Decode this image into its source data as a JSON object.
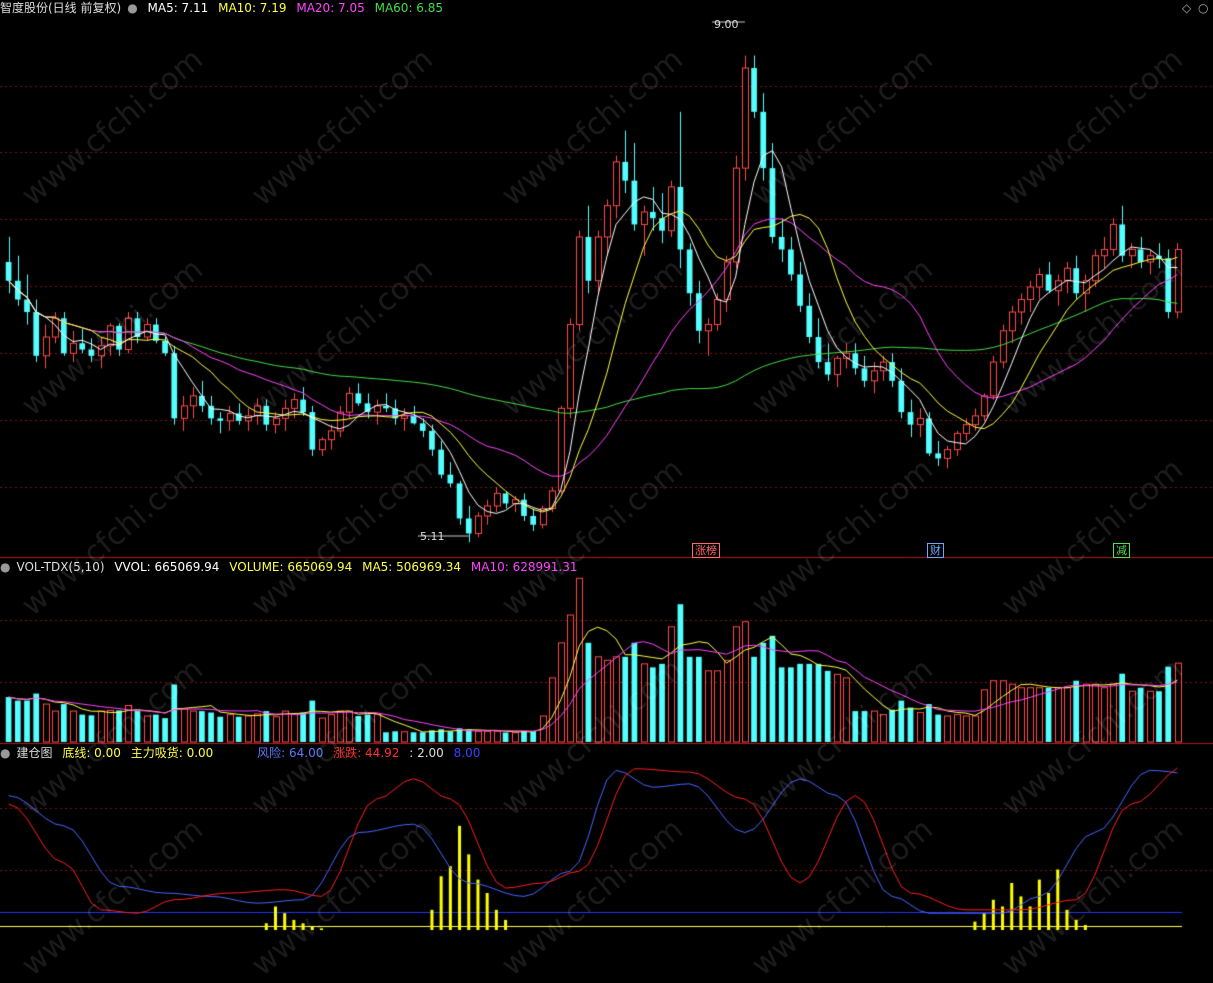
{
  "main_header": {
    "title": "智度股份(日线 前复权)",
    "ma5": "MA5: 7.11",
    "ma10": "MA10: 7.19",
    "ma20": "MA20: 7.05",
    "ma60": "MA60: 6.85"
  },
  "price_annotations": {
    "high": "9.00",
    "low": "5.11"
  },
  "event_tags": [
    "涨榜",
    "财",
    "减"
  ],
  "vol_header": {
    "title": "VOL-TDX(5,10)",
    "vvol": "VVOL: 665069.94",
    "volume": "VOLUME: 665069.94",
    "ma5": "MA5: 506969.34",
    "ma10": "MA10: 628991.31"
  },
  "ind_header": {
    "title": "建仓图",
    "bottom_line": "底线: 0.00",
    "main_absorb": "主力吸货: 0.00",
    "risk": "风险: 64.00",
    "change": "涨跌: 44.92",
    "val2": ": 2.00",
    "val8": "8.00"
  },
  "watermark": "www.cfchi.com",
  "colors": {
    "up": "#ff4a4a",
    "down": "#54ffff",
    "ma5": "#ffffff",
    "ma10": "#ffff44",
    "ma20": "#ff44ff",
    "ma60": "#44dd44",
    "grid": "#7a1010",
    "risk": "#4a66ff",
    "change": "#ff2020",
    "absorb": "#ffff00"
  },
  "chart_data": {
    "type": "candlestick",
    "price_range": [
      5.0,
      9.3
    ],
    "candles": [
      [
        7.35,
        7.55,
        7.1,
        7.2
      ],
      [
        7.2,
        7.4,
        7.0,
        7.05
      ],
      [
        7.05,
        7.25,
        6.85,
        6.95
      ],
      [
        6.95,
        7.05,
        6.55,
        6.6
      ],
      [
        6.6,
        6.85,
        6.5,
        6.75
      ],
      [
        6.75,
        6.95,
        6.7,
        6.9
      ],
      [
        6.9,
        6.95,
        6.6,
        6.62
      ],
      [
        6.62,
        6.8,
        6.55,
        6.7
      ],
      [
        6.7,
        6.82,
        6.62,
        6.65
      ],
      [
        6.65,
        6.74,
        6.55,
        6.6
      ],
      [
        6.6,
        6.75,
        6.5,
        6.68
      ],
      [
        6.68,
        6.86,
        6.6,
        6.84
      ],
      [
        6.84,
        6.86,
        6.6,
        6.65
      ],
      [
        6.65,
        6.95,
        6.62,
        6.9
      ],
      [
        6.9,
        6.95,
        6.7,
        6.75
      ],
      [
        6.75,
        6.9,
        6.72,
        6.85
      ],
      [
        6.85,
        6.9,
        6.7,
        6.72
      ],
      [
        6.72,
        6.75,
        6.6,
        6.62
      ],
      [
        6.62,
        6.68,
        6.05,
        6.1
      ],
      [
        6.1,
        6.28,
        6.0,
        6.2
      ],
      [
        6.2,
        6.35,
        6.1,
        6.28
      ],
      [
        6.28,
        6.4,
        6.15,
        6.2
      ],
      [
        6.2,
        6.28,
        6.05,
        6.1
      ],
      [
        6.1,
        6.15,
        5.98,
        6.08
      ],
      [
        6.08,
        6.2,
        6.0,
        6.14
      ],
      [
        6.14,
        6.22,
        6.05,
        6.08
      ],
      [
        6.08,
        6.18,
        6.0,
        6.12
      ],
      [
        6.12,
        6.26,
        6.05,
        6.2
      ],
      [
        6.2,
        6.25,
        6.0,
        6.05
      ],
      [
        6.05,
        6.15,
        5.98,
        6.1
      ],
      [
        6.1,
        6.25,
        6.0,
        6.18
      ],
      [
        6.18,
        6.3,
        6.1,
        6.25
      ],
      [
        6.25,
        6.35,
        6.12,
        6.15
      ],
      [
        6.15,
        6.2,
        5.8,
        5.85
      ],
      [
        5.85,
        5.95,
        5.8,
        5.93
      ],
      [
        5.93,
        6.05,
        5.85,
        6.0
      ],
      [
        6.0,
        6.2,
        5.95,
        6.15
      ],
      [
        6.15,
        6.35,
        6.1,
        6.3
      ],
      [
        6.3,
        6.38,
        6.2,
        6.22
      ],
      [
        6.22,
        6.3,
        6.1,
        6.15
      ],
      [
        6.15,
        6.25,
        6.05,
        6.2
      ],
      [
        6.2,
        6.3,
        6.15,
        6.18
      ],
      [
        6.18,
        6.25,
        6.05,
        6.1
      ],
      [
        6.1,
        6.18,
        6.0,
        6.12
      ],
      [
        6.12,
        6.2,
        6.05,
        6.06
      ],
      [
        6.06,
        6.1,
        5.95,
        6.0
      ],
      [
        6.0,
        6.05,
        5.8,
        5.85
      ],
      [
        5.85,
        5.92,
        5.62,
        5.65
      ],
      [
        5.65,
        5.75,
        5.55,
        5.58
      ],
      [
        5.58,
        5.6,
        5.25,
        5.3
      ],
      [
        5.3,
        5.4,
        5.11,
        5.18
      ],
      [
        5.18,
        5.35,
        5.15,
        5.32
      ],
      [
        5.32,
        5.45,
        5.25,
        5.4
      ],
      [
        5.4,
        5.55,
        5.35,
        5.5
      ],
      [
        5.5,
        5.52,
        5.38,
        5.42
      ],
      [
        5.42,
        5.48,
        5.35,
        5.45
      ],
      [
        5.45,
        5.5,
        5.28,
        5.32
      ],
      [
        5.32,
        5.38,
        5.2,
        5.25
      ],
      [
        5.25,
        5.4,
        5.22,
        5.38
      ],
      [
        5.38,
        5.55,
        5.35,
        5.52
      ],
      [
        5.52,
        6.2,
        5.5,
        6.18
      ],
      [
        6.18,
        6.9,
        6.1,
        6.85
      ],
      [
        6.85,
        7.6,
        6.8,
        7.55
      ],
      [
        7.55,
        7.8,
        7.1,
        7.2
      ],
      [
        7.2,
        7.6,
        7.1,
        7.55
      ],
      [
        7.55,
        7.85,
        7.4,
        7.8
      ],
      [
        7.8,
        8.2,
        7.7,
        8.15
      ],
      [
        8.15,
        8.4,
        7.9,
        8.0
      ],
      [
        8.0,
        8.3,
        7.6,
        7.65
      ],
      [
        7.65,
        7.8,
        7.4,
        7.75
      ],
      [
        7.75,
        7.95,
        7.6,
        7.7
      ],
      [
        7.7,
        7.9,
        7.5,
        7.6
      ],
      [
        7.6,
        8.0,
        7.55,
        7.95
      ],
      [
        7.95,
        8.55,
        7.3,
        7.45
      ],
      [
        7.45,
        7.5,
        7.0,
        7.1
      ],
      [
        7.1,
        7.2,
        6.7,
        6.8
      ],
      [
        6.8,
        6.9,
        6.6,
        6.85
      ],
      [
        6.85,
        7.1,
        6.8,
        7.05
      ],
      [
        7.05,
        7.4,
        6.95,
        7.35
      ],
      [
        7.35,
        8.2,
        7.3,
        8.1
      ],
      [
        8.1,
        9.0,
        8.0,
        8.9
      ],
      [
        8.9,
        9.0,
        8.5,
        8.55
      ],
      [
        8.55,
        8.7,
        8.0,
        8.1
      ],
      [
        8.1,
        8.3,
        7.5,
        7.55
      ],
      [
        7.55,
        7.7,
        7.35,
        7.45
      ],
      [
        7.45,
        7.55,
        7.2,
        7.25
      ],
      [
        7.25,
        7.35,
        6.95,
        7.0
      ],
      [
        7.0,
        7.1,
        6.7,
        6.75
      ],
      [
        6.75,
        6.9,
        6.5,
        6.55
      ],
      [
        6.55,
        6.7,
        6.4,
        6.45
      ],
      [
        6.45,
        6.6,
        6.35,
        6.58
      ],
      [
        6.58,
        6.7,
        6.5,
        6.62
      ],
      [
        6.62,
        6.7,
        6.45,
        6.5
      ],
      [
        6.5,
        6.6,
        6.35,
        6.4
      ],
      [
        6.4,
        6.55,
        6.3,
        6.48
      ],
      [
        6.48,
        6.6,
        6.4,
        6.55
      ],
      [
        6.55,
        6.62,
        6.35,
        6.4
      ],
      [
        6.4,
        6.5,
        6.1,
        6.15
      ],
      [
        6.15,
        6.25,
        5.95,
        6.05
      ],
      [
        6.05,
        6.18,
        5.95,
        6.1
      ],
      [
        6.1,
        6.15,
        5.8,
        5.82
      ],
      [
        5.82,
        5.92,
        5.72,
        5.78
      ],
      [
        5.78,
        5.88,
        5.7,
        5.85
      ],
      [
        5.85,
        6.0,
        5.8,
        5.98
      ],
      [
        5.98,
        6.1,
        5.92,
        6.05
      ],
      [
        6.05,
        6.18,
        6.0,
        6.12
      ],
      [
        6.12,
        6.3,
        6.08,
        6.28
      ],
      [
        6.28,
        6.6,
        6.25,
        6.55
      ],
      [
        6.55,
        6.85,
        6.5,
        6.8
      ],
      [
        6.8,
        7.0,
        6.7,
        6.95
      ],
      [
        6.95,
        7.1,
        6.85,
        7.05
      ],
      [
        7.05,
        7.2,
        6.95,
        7.15
      ],
      [
        7.15,
        7.3,
        7.05,
        7.25
      ],
      [
        7.25,
        7.35,
        7.1,
        7.12
      ],
      [
        7.12,
        7.25,
        7.0,
        7.2
      ],
      [
        7.2,
        7.35,
        7.1,
        7.3
      ],
      [
        7.3,
        7.4,
        7.05,
        7.1
      ],
      [
        7.1,
        7.25,
        6.95,
        7.2
      ],
      [
        7.2,
        7.45,
        7.15,
        7.4
      ],
      [
        7.4,
        7.55,
        7.3,
        7.45
      ],
      [
        7.45,
        7.7,
        7.4,
        7.65
      ],
      [
        7.65,
        7.8,
        7.35,
        7.4
      ],
      [
        7.4,
        7.5,
        7.3,
        7.45
      ],
      [
        7.45,
        7.55,
        7.3,
        7.35
      ],
      [
        7.35,
        7.45,
        7.25,
        7.4
      ],
      [
        7.4,
        7.5,
        7.3,
        7.38
      ],
      [
        7.38,
        7.45,
        6.9,
        6.95
      ],
      [
        6.95,
        7.5,
        6.9,
        7.45
      ]
    ]
  }
}
